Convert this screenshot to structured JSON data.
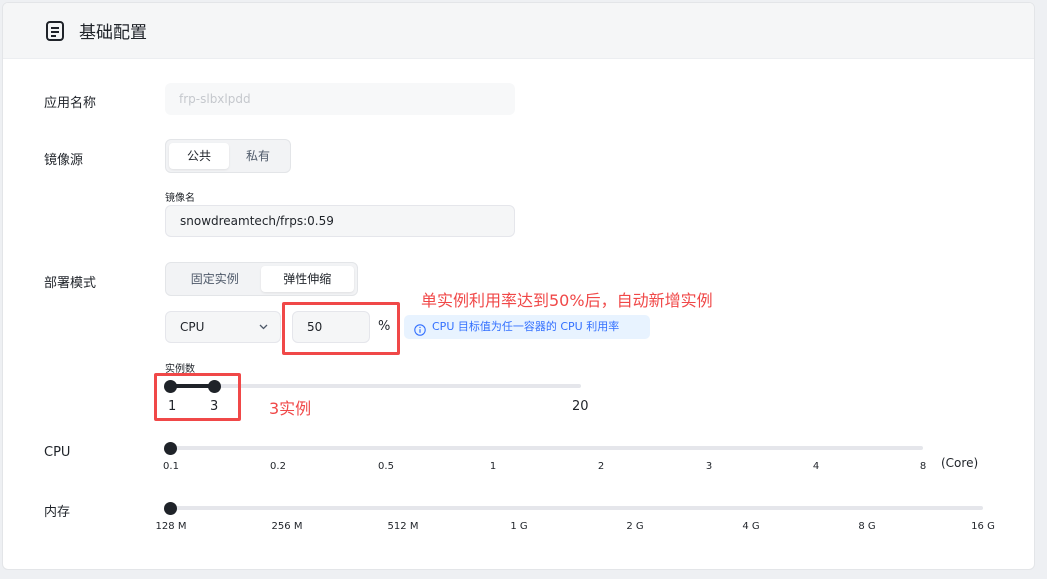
{
  "header": {
    "title": "基础配置",
    "icon": "document-icon"
  },
  "app_name": {
    "label": "应用名称",
    "value": "frp-slbxlpdd"
  },
  "image_source": {
    "label": "镜像源",
    "options": [
      "公共",
      "私有"
    ],
    "selected": "公共",
    "image_name_label": "镜像名",
    "image_name_value": "snowdreamtech/frps:0.59"
  },
  "deploy_mode": {
    "label": "部署模式",
    "options": [
      "固定实例",
      "弹性伸缩"
    ],
    "selected": "弹性伸缩",
    "metric": "CPU",
    "threshold": "50",
    "unit": "%",
    "tip": "CPU 目标值为任一容器的 CPU 利用率",
    "instances_label": "实例数",
    "instances_min": "1",
    "instances_max": "3",
    "instances_range_max": "20"
  },
  "cpu": {
    "label": "CPU",
    "ticks": [
      "0.1",
      "0.2",
      "0.5",
      "1",
      "2",
      "3",
      "4",
      "8"
    ],
    "unit": "(Core)",
    "selected": "0.1"
  },
  "memory": {
    "label": "内存",
    "ticks": [
      "128 M",
      "256 M",
      "512 M",
      "1 G",
      "2 G",
      "4 G",
      "8 G",
      "16 G"
    ],
    "selected": "128 M"
  },
  "annotations": {
    "autoscale_note": "单实例利用率达到50%后，自动新增实例",
    "instances_note": "3实例"
  },
  "colors": {
    "annotation_red": "#f04848",
    "info_blue": "#3370ff",
    "knob": "#1f2329"
  }
}
